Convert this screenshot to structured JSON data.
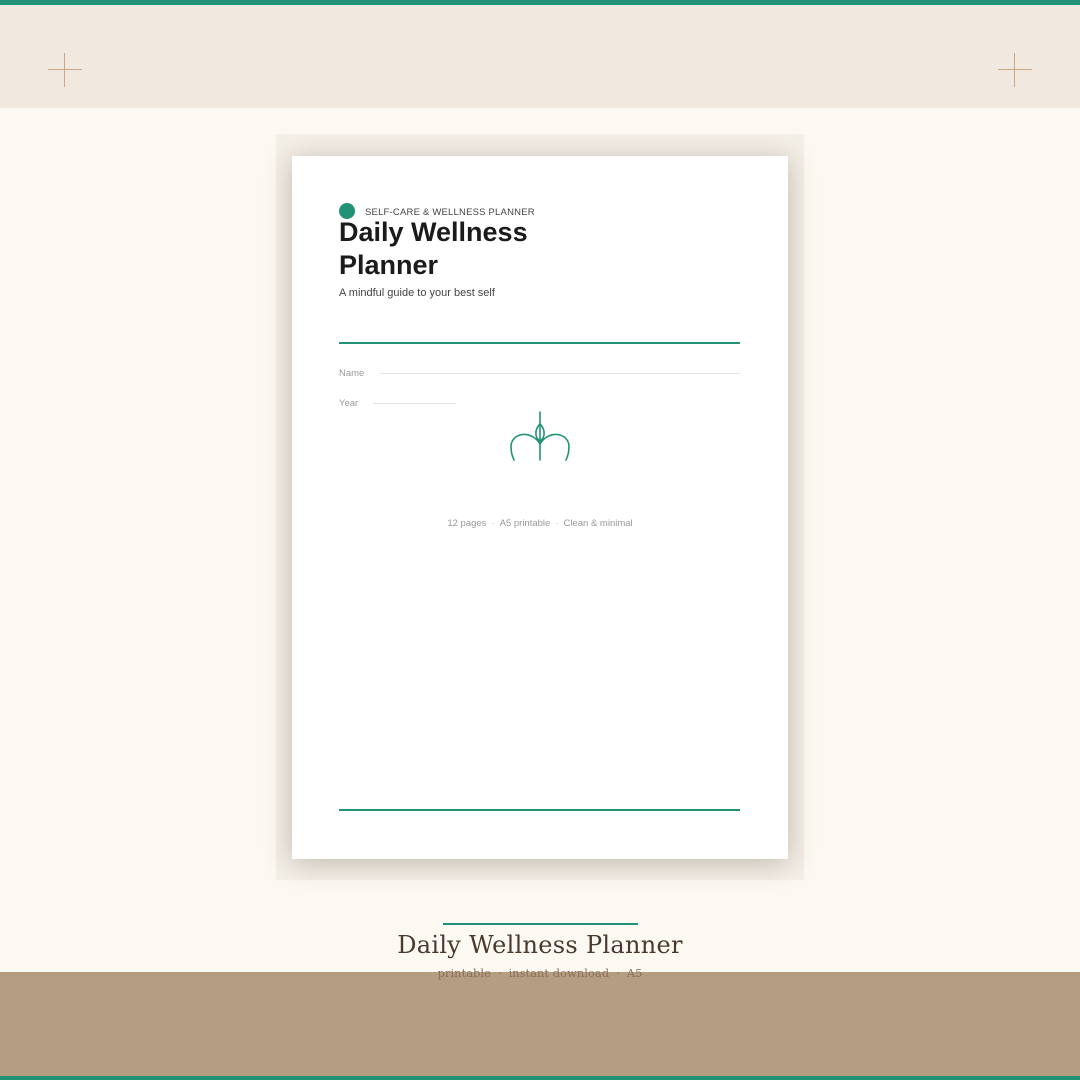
{
  "brand": {
    "accent_color": "#219276",
    "band_color": "#f1e9df",
    "footer_color": "#b49d81",
    "background_color": "#fcf9f2"
  },
  "cover": {
    "eyebrow": "SELF-CARE & WELLNESS PLANNER",
    "title": "Daily Wellness Planner",
    "subtitle": "A mindful guide to your best self",
    "fields": {
      "name_label": "Name",
      "year_label": "Year"
    },
    "motif_icon": "lotus-icon",
    "meta": [
      "12 pages",
      "A5 printable",
      "Clean & minimal"
    ]
  },
  "caption": {
    "title": "Daily Wellness Planner",
    "tags": [
      "printable",
      "instant download",
      "A5"
    ]
  }
}
